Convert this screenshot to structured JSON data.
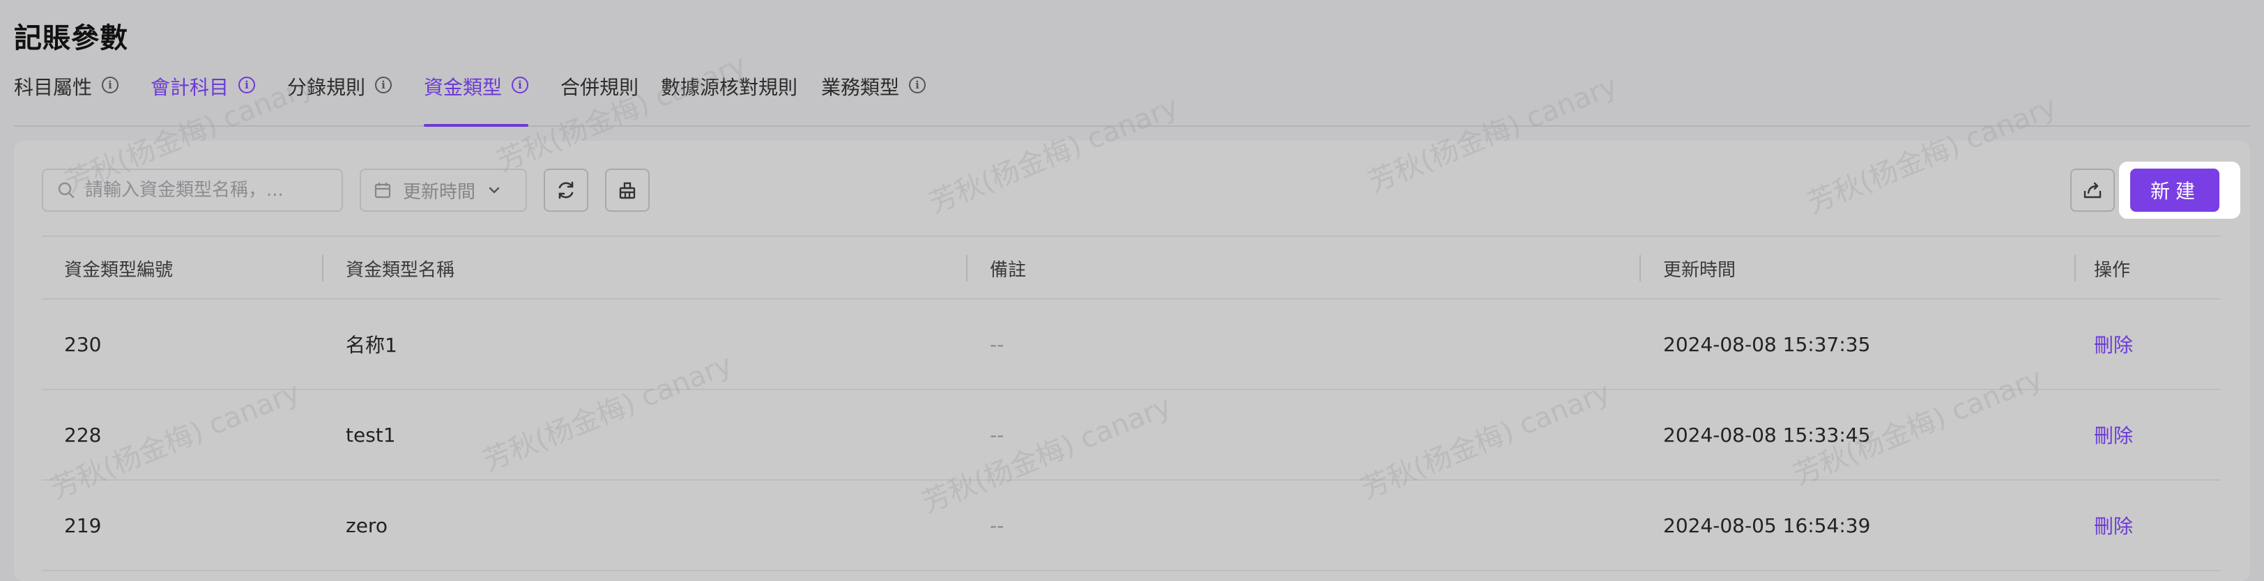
{
  "page": {
    "title": "記賬參數"
  },
  "tabs": [
    {
      "label": "科目屬性",
      "info": true,
      "state": "normal"
    },
    {
      "label": "會計科目",
      "info": true,
      "state": "purple"
    },
    {
      "label": "分錄規則",
      "info": true,
      "state": "normal"
    },
    {
      "label": "資金類型",
      "info": true,
      "state": "active"
    },
    {
      "label": "合併規則",
      "info": false,
      "state": "normal"
    },
    {
      "label": "數據源核對規則",
      "info": false,
      "state": "normal"
    },
    {
      "label": "業務類型",
      "info": true,
      "state": "normal"
    }
  ],
  "toolbar": {
    "search_placeholder": "請輸入資金類型名稱，...",
    "date_filter_label": "更新時間",
    "refresh_icon": "refresh-icon",
    "clear_icon": "clear-icon",
    "export_icon": "export-icon",
    "new_label": "新建"
  },
  "table": {
    "columns": [
      "資金類型編號",
      "資金類型名稱",
      "備註",
      "更新時間",
      "操作"
    ],
    "rows": [
      {
        "id": "230",
        "name": "名称1",
        "note": "--",
        "updated": "2024-08-08 15:37:35",
        "action": "刪除"
      },
      {
        "id": "228",
        "name": "test1",
        "note": "--",
        "updated": "2024-08-08 15:33:45",
        "action": "刪除"
      },
      {
        "id": "219",
        "name": "zero",
        "note": "--",
        "updated": "2024-08-05 16:54:39",
        "action": "刪除"
      }
    ]
  },
  "watermark": "芳秋(杨金梅) canary",
  "colors": {
    "accent": "#7a3fe4",
    "background": "#c4c4c6",
    "card": "#cacacb"
  }
}
